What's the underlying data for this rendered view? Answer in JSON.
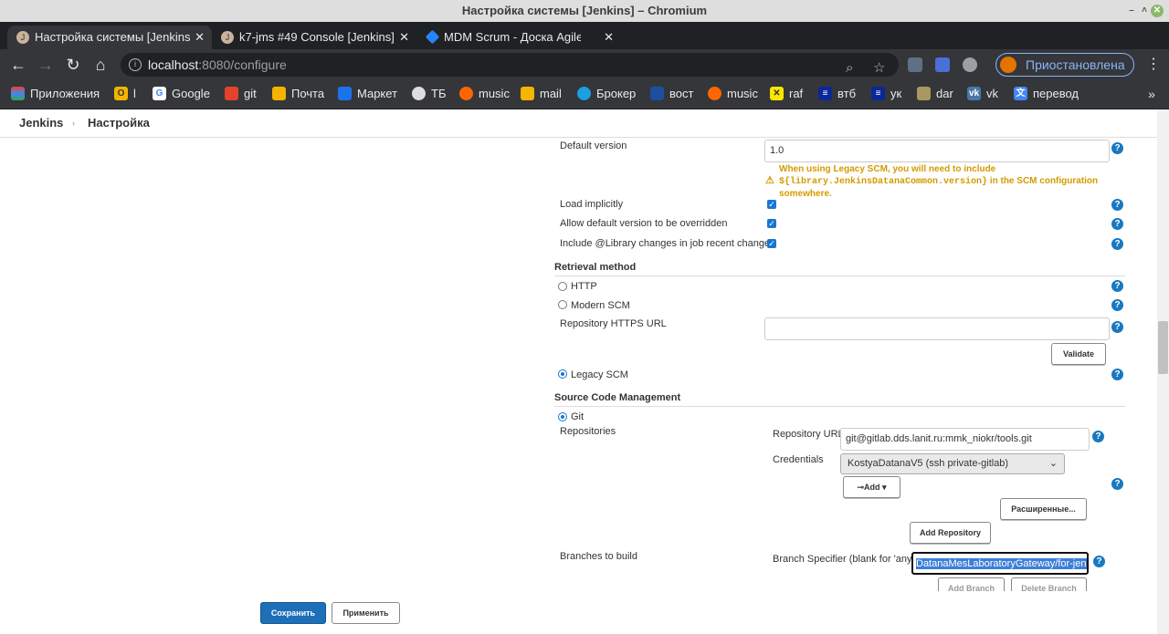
{
  "window": {
    "title": "Настройка системы [Jenkins] – Chromium"
  },
  "tabs": [
    {
      "label": "Настройка системы [Jenkins]",
      "active": true
    },
    {
      "label": "k7-jms #49 Console [Jenkins]",
      "active": false
    },
    {
      "label": "MDM Scrum - Доска Agile - Д",
      "active": false
    }
  ],
  "address": {
    "host": "localhost",
    "path": ":8080/configure"
  },
  "profile": {
    "label": "Приостановлена"
  },
  "bookmarks": [
    {
      "label": "Приложения",
      "icon": "apps-grid-icon"
    },
    {
      "label": "l",
      "icon": "yandex-icon"
    },
    {
      "label": "Google",
      "icon": "google-icon"
    },
    {
      "label": "git",
      "icon": "gitlab-icon"
    },
    {
      "label": "Почта",
      "icon": "mail-icon"
    },
    {
      "label": "Маркет",
      "icon": "cart-icon"
    },
    {
      "label": "ТБ",
      "icon": "bank-icon"
    },
    {
      "label": "music",
      "icon": "music-icon"
    },
    {
      "label": "mail",
      "icon": "mail-icon"
    },
    {
      "label": "Брокер",
      "icon": "broker-icon"
    },
    {
      "label": "вост",
      "icon": "bank-icon"
    },
    {
      "label": "music",
      "icon": "music-icon"
    },
    {
      "label": "raf",
      "icon": "raiffeisen-icon"
    },
    {
      "label": "втб",
      "icon": "vtb-icon"
    },
    {
      "label": "ук",
      "icon": "vtb-icon"
    },
    {
      "label": "dar",
      "icon": "link-icon"
    },
    {
      "label": "vk",
      "icon": "vk-icon"
    },
    {
      "label": "перевод",
      "icon": "translate-icon"
    }
  ],
  "breadcrumb": {
    "root": "Jenkins",
    "page": "Настройка"
  },
  "library": {
    "default_version_label": "Default version",
    "default_version_value": "1.0",
    "warning_line1": "When using Legacy SCM, you will need to include",
    "warning_code": "${library.JenkinsDatanaCommon.version}",
    "warning_line2": " in the SCM configuration",
    "warning_line3": "somewhere.",
    "load_implicitly": "Load implicitly",
    "allow_override": "Allow default version to be overridden",
    "include_changes": "Include @Library changes in job recent changes"
  },
  "retrieval": {
    "section": "Retrieval method",
    "http": "HTTP",
    "modern_scm": "Modern SCM",
    "https_url_label": "Repository HTTPS URL",
    "https_url_value": "",
    "validate": "Validate",
    "legacy_scm": "Legacy SCM"
  },
  "scm": {
    "section": "Source Code Management",
    "git": "Git",
    "repositories": "Repositories",
    "repo_url_label": "Repository URL",
    "repo_url_value": "git@gitlab.dds.lanit.ru:mmk_niokr/tools.git",
    "credentials_label": "Credentials",
    "credentials_value": "KostyaDatanaV5 (ssh private-gitlab)",
    "add": "Add",
    "advanced": "Расширенные...",
    "add_repository": "Add Repository",
    "branches_label": "Branches to build",
    "branch_specifier_label": "Branch Specifier (blank for 'any')",
    "branch_specifier_value": "DatanaMesLaboratoryGateway/for-jenins",
    "add_branch": "Add Branch",
    "delete_branch": "Delete Branch"
  },
  "footer": {
    "save": "Сохранить",
    "apply": "Применить"
  },
  "colors": {
    "accent": "#1d6fb8",
    "help": "#1978bf",
    "warning": "#d39b00"
  }
}
